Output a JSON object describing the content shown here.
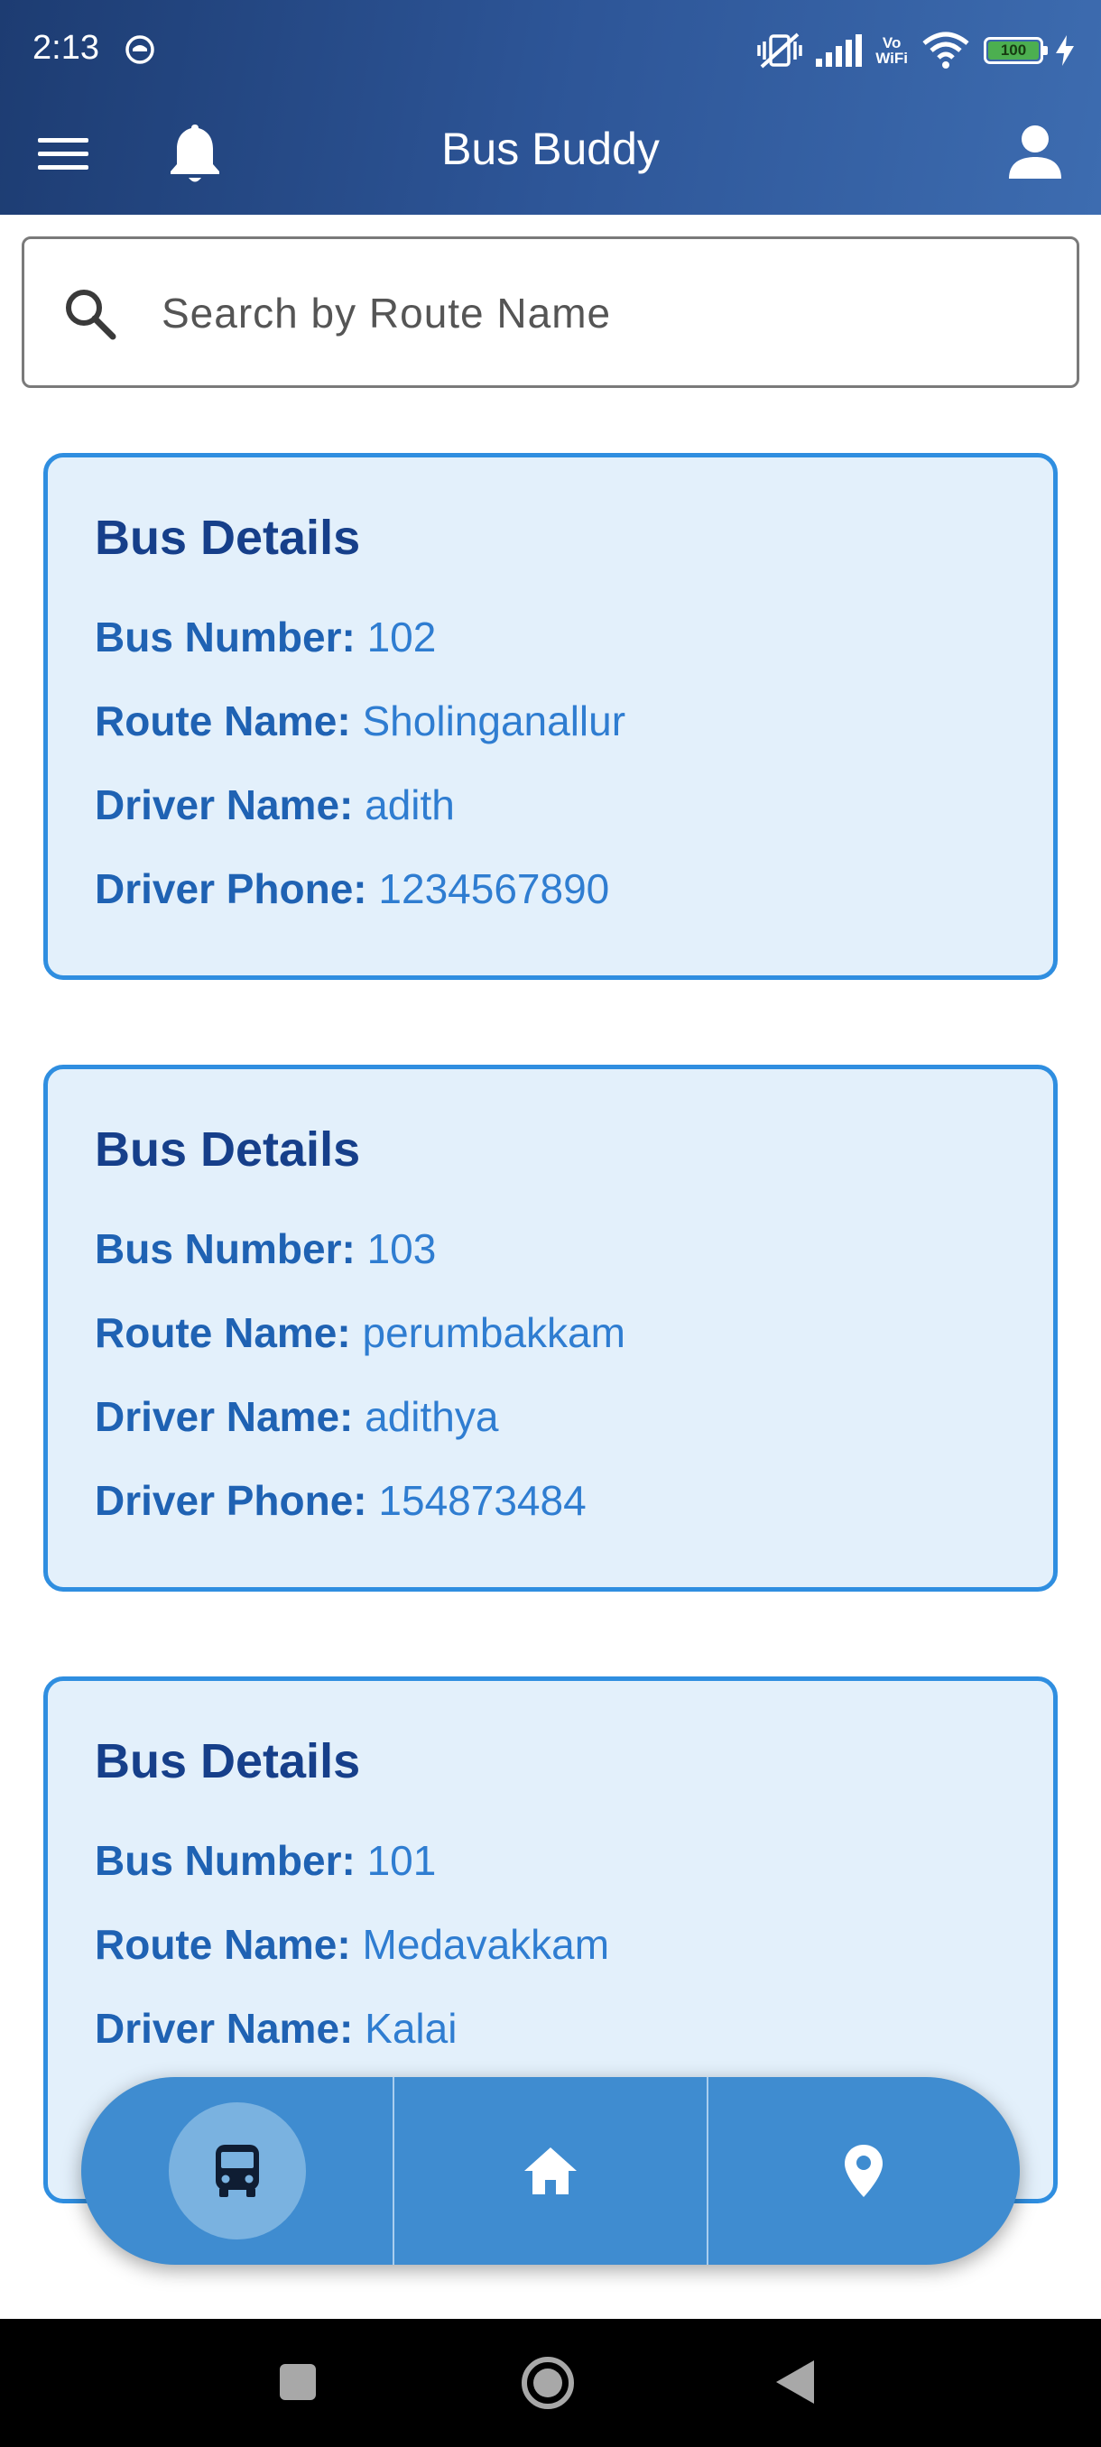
{
  "status_bar": {
    "time": "2:13",
    "vowifi_top": "Vo",
    "vowifi_bottom": "WiFi",
    "battery_level": "100"
  },
  "app_bar": {
    "title": "Bus Buddy"
  },
  "search": {
    "placeholder": "Search by Route Name",
    "value": ""
  },
  "buses": [
    {
      "title": "Bus Details",
      "bus_number_label": "Bus Number:",
      "bus_number": "102",
      "route_name_label": "Route Name:",
      "route_name": "Sholinganallur",
      "driver_name_label": "Driver Name:",
      "driver_name": "adith",
      "driver_phone_label": "Driver Phone:",
      "driver_phone": "1234567890"
    },
    {
      "title": "Bus Details",
      "bus_number_label": "Bus Number:",
      "bus_number": "103",
      "route_name_label": "Route Name:",
      "route_name": "perumbakkam",
      "driver_name_label": "Driver Name:",
      "driver_name": "adithya",
      "driver_phone_label": "Driver Phone:",
      "driver_phone": "154873484"
    },
    {
      "title": "Bus Details",
      "bus_number_label": "Bus Number:",
      "bus_number": "101",
      "route_name_label": "Route Name:",
      "route_name": "Medavakkam",
      "driver_name_label": "Driver Name:",
      "driver_name": "Kalai"
    }
  ],
  "bottom_nav": {
    "items": [
      {
        "icon": "bus-icon",
        "active": true
      },
      {
        "icon": "home-icon",
        "active": false
      },
      {
        "icon": "location-pin-icon",
        "active": false
      }
    ]
  },
  "colors": {
    "app_bar_start": "#1d3c72",
    "app_bar_end": "#3d6cb0",
    "card_background": "#e3f0fb",
    "card_border": "#2f8ee0",
    "card_title": "#163f8a",
    "label": "#1f62b3",
    "value": "#2f7dd1",
    "bottom_nav": "#3f8cd0"
  }
}
